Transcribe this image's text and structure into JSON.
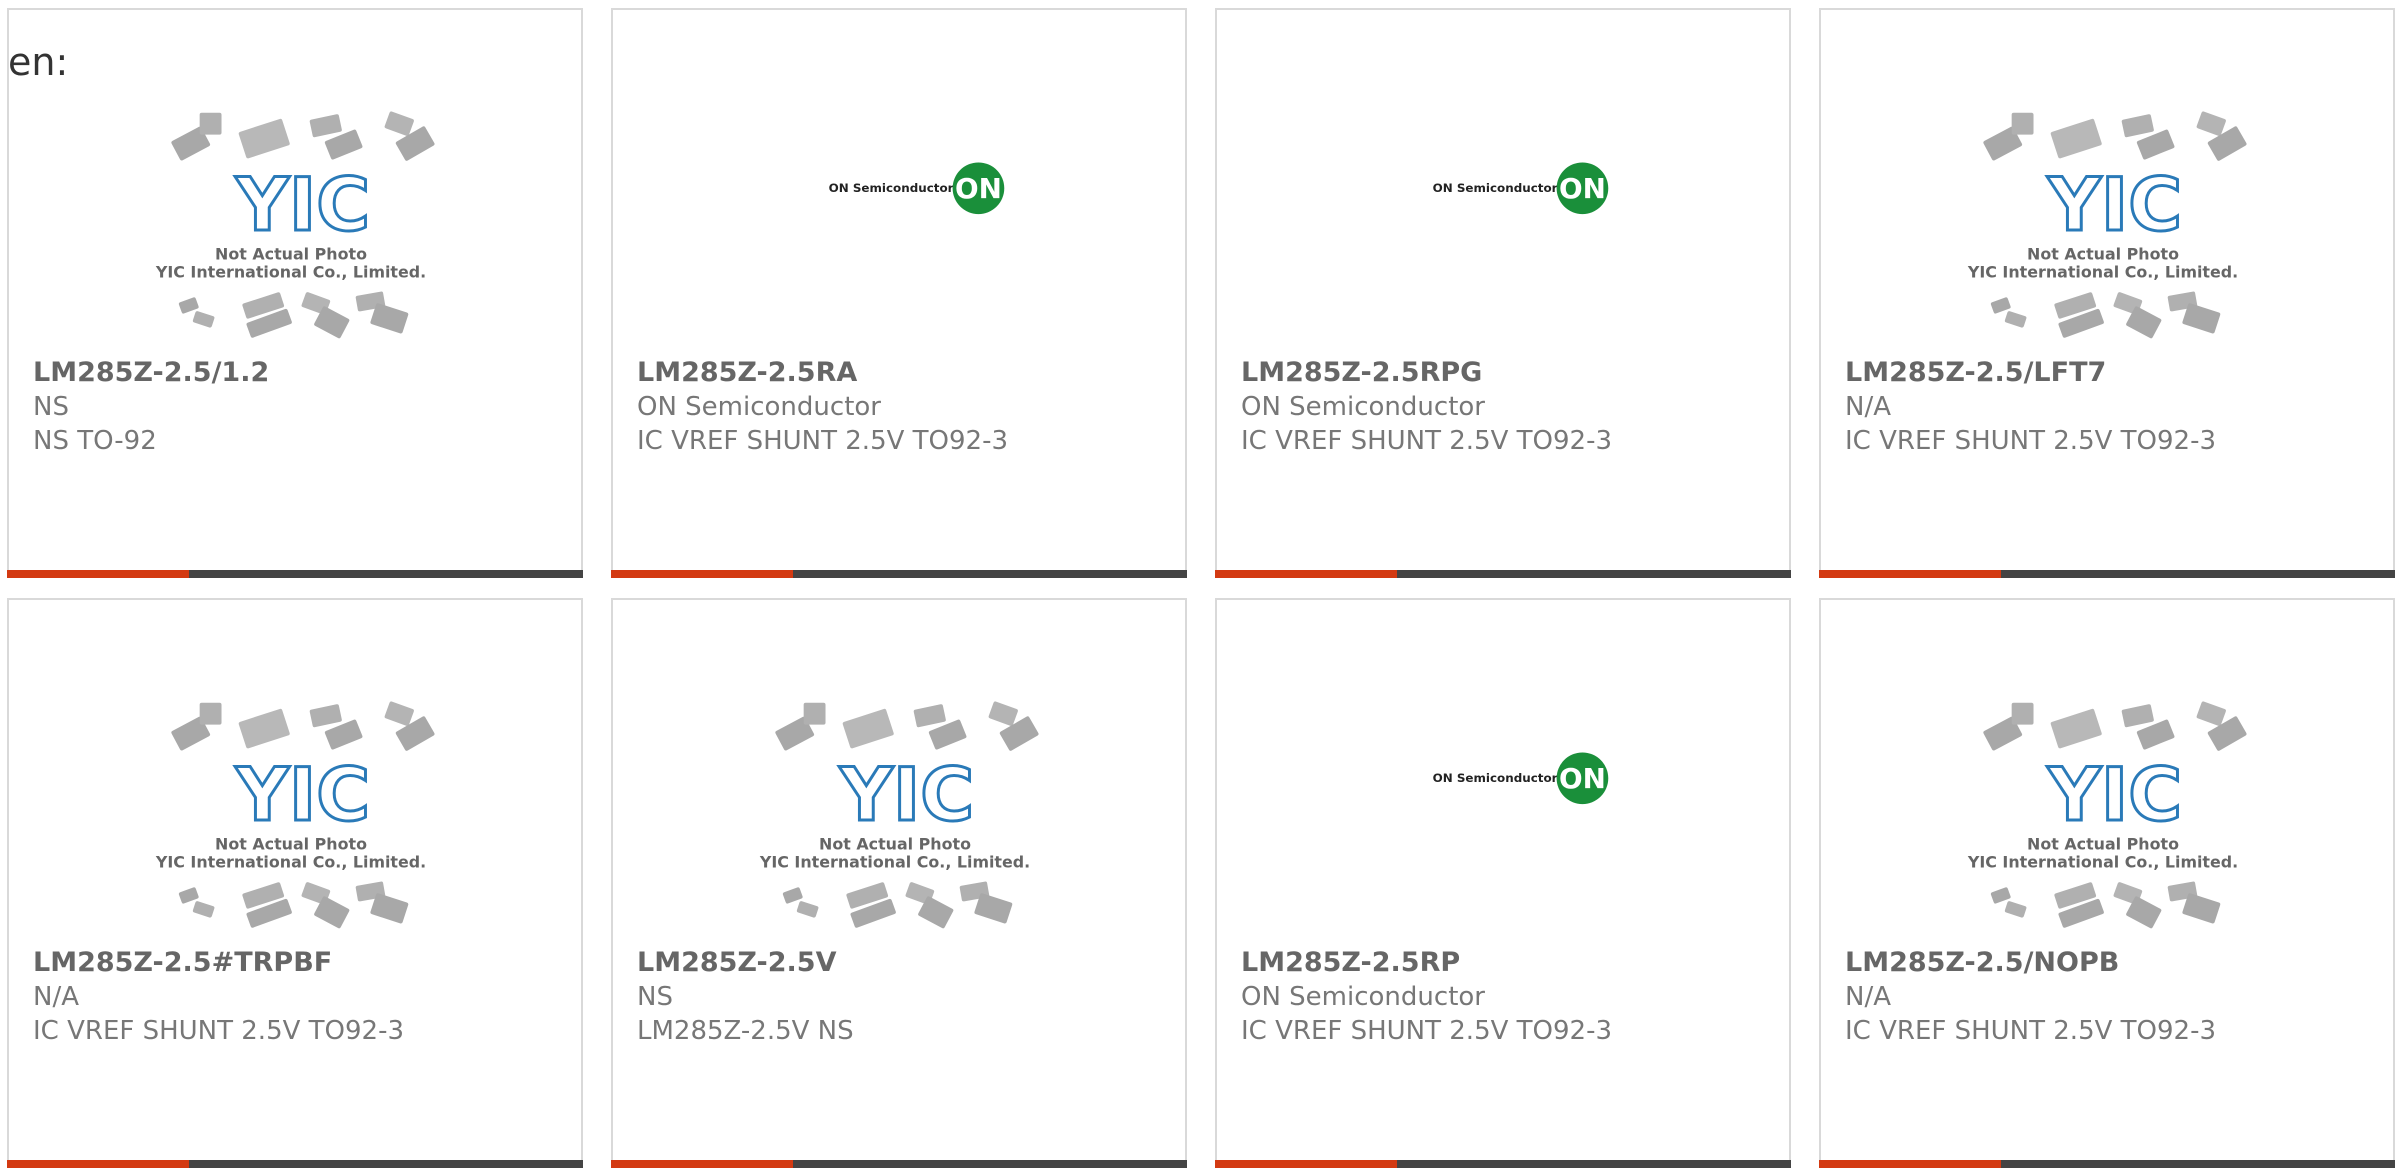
{
  "language_label": "en:",
  "colors": {
    "accent": "#d33a12",
    "bar": "#444444",
    "yic_blue": "#2a7ab8",
    "on_green": "#1a8f3a",
    "text_part": "#666666",
    "text_meta": "#777777"
  },
  "placeholder": {
    "line1": "Not Actual Photo",
    "line2": "YIC International Co., Limited."
  },
  "on_logo": {
    "wordmark": "ON Semiconductor",
    "badge": "ON"
  },
  "products": [
    {
      "part": "LM285Z-2.5/1.2",
      "manufacturer": "NS",
      "description": "NS TO-92",
      "image": "yic-placeholder"
    },
    {
      "part": "LM285Z-2.5RA",
      "manufacturer": "ON Semiconductor",
      "description": "IC VREF SHUNT 2.5V TO92-3",
      "image": "on-semiconductor-logo"
    },
    {
      "part": "LM285Z-2.5RPG",
      "manufacturer": "ON Semiconductor",
      "description": "IC VREF SHUNT 2.5V TO92-3",
      "image": "on-semiconductor-logo"
    },
    {
      "part": "LM285Z-2.5/LFT7",
      "manufacturer": "N/A",
      "description": "IC VREF SHUNT 2.5V TO92-3",
      "image": "yic-placeholder"
    },
    {
      "part": "LM285Z-2.5#TRPBF",
      "manufacturer": "N/A",
      "description": "IC VREF SHUNT 2.5V TO92-3",
      "image": "yic-placeholder"
    },
    {
      "part": "LM285Z-2.5V",
      "manufacturer": "NS",
      "description": "LM285Z-2.5V NS",
      "image": "yic-placeholder"
    },
    {
      "part": "LM285Z-2.5RP",
      "manufacturer": "ON Semiconductor",
      "description": "IC VREF SHUNT 2.5V TO92-3",
      "image": "on-semiconductor-logo"
    },
    {
      "part": "LM285Z-2.5/NOPB",
      "manufacturer": "N/A",
      "description": "IC VREF SHUNT 2.5V TO92-3",
      "image": "yic-placeholder"
    }
  ]
}
